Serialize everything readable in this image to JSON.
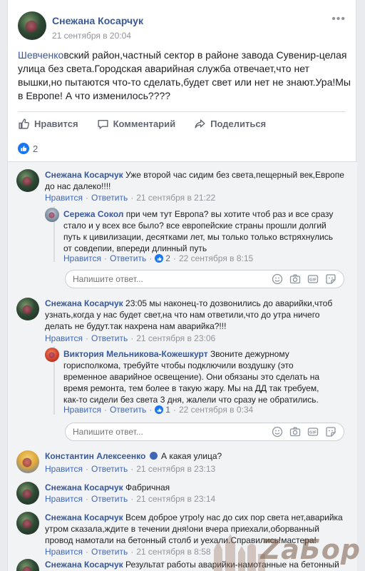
{
  "post": {
    "author": "Снежана Косарчук",
    "date": "21 сентября в 20:04",
    "text_link": "Шевченко",
    "text_rest": "вский район,частный сектор в районе завода Сувенир-целая улица без света.Городская аварийная служба отвечает,что нет вышки,но пытаются что-то сделать,будет свет или нет не знают.Ура!Мы в Европе! А что изменилось????",
    "actions": {
      "like": "Нравится",
      "comment": "Комментарий",
      "share": "Поделиться"
    },
    "reactions_count": "2"
  },
  "comments": [
    {
      "author": "Снежана Косарчук",
      "text": "Уже второй час сидим без света,пещерный век,Европе до нас далеко!!!!",
      "like": "Нравится",
      "reply": "Ответить",
      "time": "21 сентября в 21:22",
      "reply_item": {
        "author": "Сережа Сокол",
        "text": "при чем тут Европа? вы хотите чтоб раз и все сразу стало и у всех все было? все европейские страны прошли долгий путь к цивилизации, десятками лет, мы только только встряхнулись от совдепии, впереди длинный путь",
        "like": "Нравится",
        "reply": "Ответить",
        "likes": "2",
        "time": "22 сентября в 8:15"
      },
      "reply_placeholder": "Напишите ответ..."
    },
    {
      "author": "Снежана Косарчук",
      "text": "23:05 мы наконец-то дозвонились до аварийки,чтоб узнать,когда у нас будет свет,на что нам ответили,что до утра ничего делать не будут.так нахрена нам аварийка?!!!",
      "like": "Нравится",
      "reply": "Ответить",
      "time": "21 сентября в 23:06",
      "reply_item": {
        "author": "Виктория Мельникова-Кожешкурт",
        "text": "Звоните дежурному горисполкома, требуйте чтобы подключили воздушку (это временное аварийное освещение). Они обязаны это сделать на время ремонта, тем более в такую жару. Мы на ДД так требуем, как-то сидели без света 3 дня, жалели что сразу не обратились.",
        "like": "Нравится",
        "reply": "Ответить",
        "likes": "1",
        "time": "22 сентября в 0:34"
      },
      "reply_placeholder": "Напишите ответ..."
    },
    {
      "author": "Константин Алексеенко",
      "text": "А какая улица?",
      "like": "Нравится",
      "reply": "Ответить",
      "time": "21 сентября в 23:13"
    },
    {
      "author": "Снежана Косарчук",
      "text": "Фабричная",
      "like": "Нравится",
      "reply": "Ответить",
      "time": "21 сентября в 23:14"
    },
    {
      "author": "Снежана Косарчук",
      "text": "Всем доброе утро!у нас до сих пор света нет,аварийка утром сказала,ждите в течении дня!они вчера приехали,оборванный провод намотали на бетонный столб и уехали.Справились!мастера!",
      "like": "Нравится",
      "reply": "Ответить",
      "time": "21 сентября в 8:58"
    },
    {
      "author": "Снежана Косарчук",
      "text": "Результат работы аварийки-намотанные на бетонный"
    }
  ],
  "watermark": "ZaБор",
  "colors": {
    "link": "#385898",
    "meta_link": "#4267b2",
    "like_badge": "#1877f2"
  }
}
